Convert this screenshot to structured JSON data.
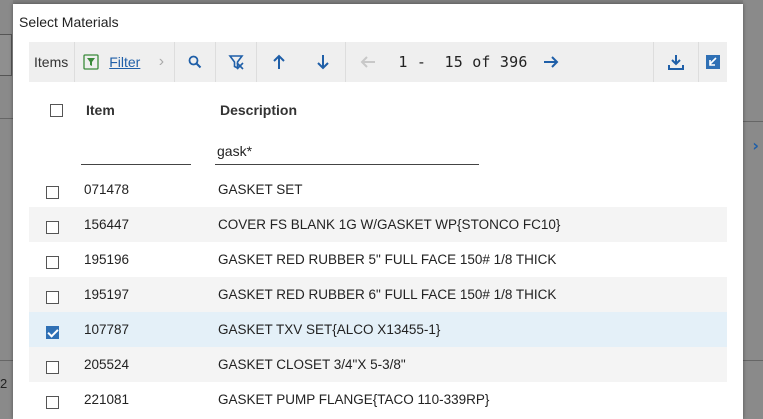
{
  "dialog": {
    "title": "Select Materials"
  },
  "toolbar": {
    "label": "Items",
    "filter_label": "Filter",
    "pager_text": "1 -  15 of 396",
    "icons": [
      "filter-funnel-icon",
      "chevron-right-icon",
      "search-icon",
      "clear-filter-icon",
      "arrow-up-icon",
      "arrow-down-icon",
      "arrow-left-icon",
      "arrow-right-icon",
      "download-icon",
      "collapse-icon"
    ]
  },
  "table": {
    "headers": {
      "item": "Item",
      "description": "Description"
    },
    "filters": {
      "item": "",
      "description": "gask*"
    },
    "rows": [
      {
        "item": "071478",
        "description": "GASKET SET",
        "checked": false
      },
      {
        "item": "156447",
        "description": "COVER FS BLANK 1G W/GASKET WP{STONCO FC10}",
        "checked": false
      },
      {
        "item": "195196",
        "description": "GASKET RED RUBBER 5\" FULL FACE 150# 1/8 THICK",
        "checked": false
      },
      {
        "item": "195197",
        "description": "GASKET RED RUBBER 6\" FULL FACE 150# 1/8 THICK",
        "checked": false
      },
      {
        "item": "107787",
        "description": "GASKET TXV SET{ALCO X13455-1}",
        "checked": true
      },
      {
        "item": "205524",
        "description": "GASKET CLOSET 3/4\"X 5-3/8\"",
        "checked": false
      },
      {
        "item": "221081",
        "description": "GASKET PUMP FLANGE{TACO 110-339RP}",
        "checked": false
      }
    ]
  },
  "background": {
    "left_digit": "2"
  },
  "colors": {
    "accent": "#1f5fa8",
    "selected_row": "#e4f0f8",
    "toolbar_bg": "#efefef",
    "alt_row": "#f4f4f4"
  }
}
